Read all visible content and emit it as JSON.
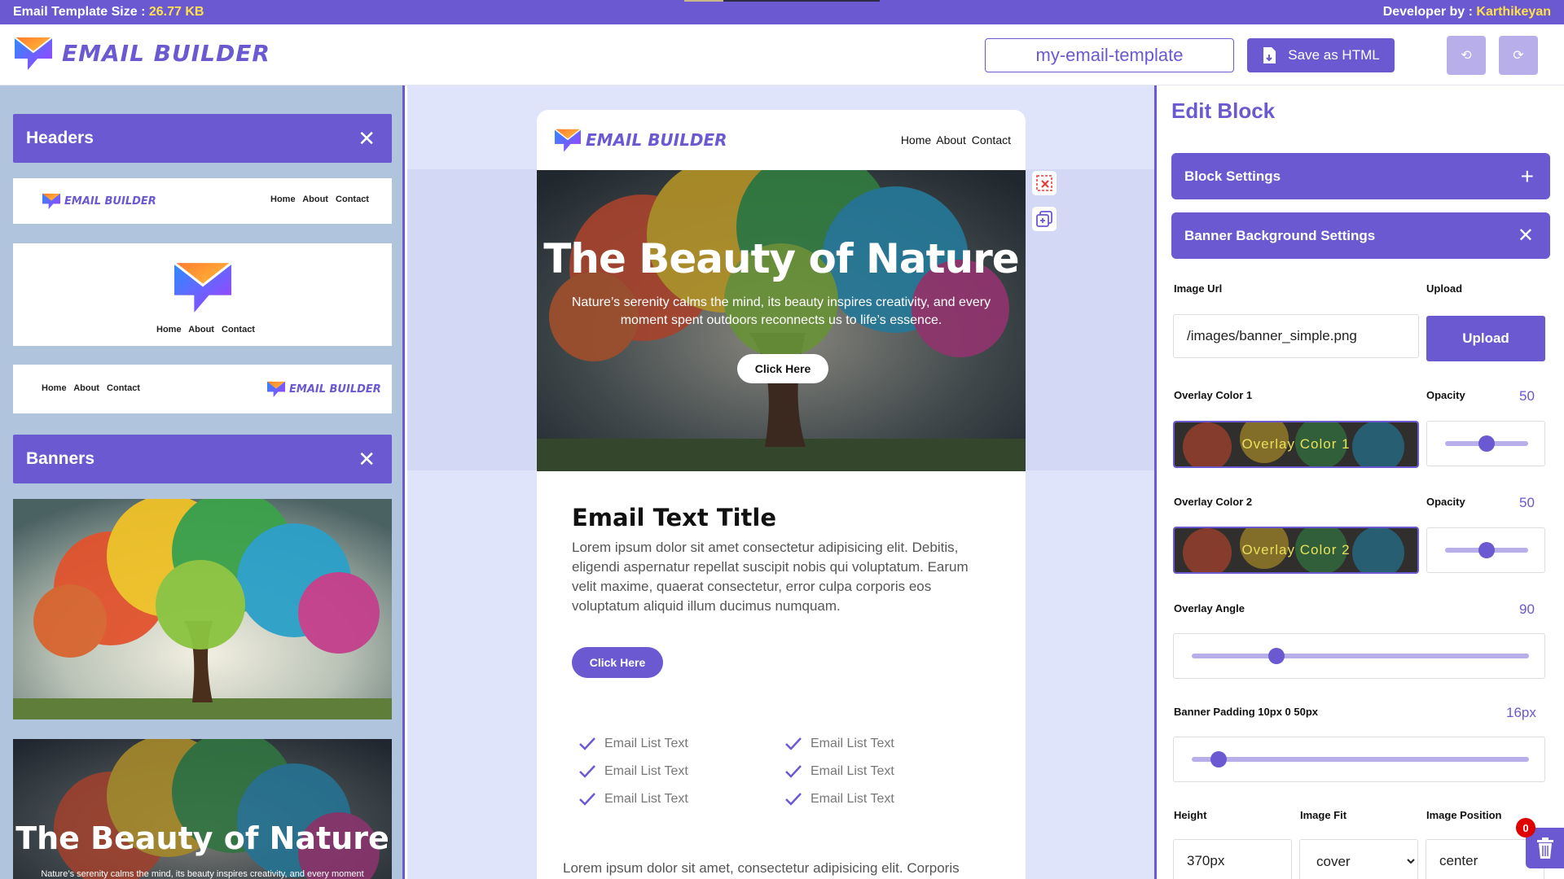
{
  "topbar": {
    "size_label": "Email Template Size : ",
    "size_value": "26.77 KB",
    "dev_label": "Developer by : ",
    "dev_name": "Karthikeyan"
  },
  "header": {
    "logo_text": "EMAIL BUILDER",
    "template_name": "my-email-template",
    "save_label": "Save as HTML"
  },
  "sidebar": {
    "headers_title": "Headers",
    "banners_title": "Banners",
    "thumb_nav": "Home About Contact",
    "thumb_logo": "EMAIL BUILDER",
    "banner2_title": "The Beauty of Nature",
    "banner2_text": "Nature’s serenity calms the mind, its beauty inspires creativity, and every moment"
  },
  "email": {
    "logo_text": "EMAIL BUILDER",
    "nav": "Home  About  Contact",
    "banner_title": "The Beauty of Nature",
    "banner_text": "Nature’s serenity calms the mind, its beauty inspires creativity, and every moment spent outdoors reconnects us to life’s essence.",
    "banner_button": "Click Here",
    "text_title": "Email Text Title",
    "text_body": "Lorem ipsum dolor sit amet consectetur adipisicing elit. Debitis, eligendi aspernatur repellat suscipit nobis qui voluptatum. Earum velit maxime, quaerat consectetur, error culpa corporis eos voluptatum aliquid illum ducimus numquam.",
    "text_button": "Click Here",
    "list_left": [
      "Email List Text",
      "Email List Text",
      "Email List Text"
    ],
    "list_right": [
      "Email List Text",
      "Email List Text",
      "Email List Text"
    ],
    "footer_text": "Lorem ipsum dolor sit amet, consectetur adipisicing elit. Corporis consequatur sequi ipsa commodi cumque vero unde, itaque"
  },
  "panel": {
    "title": "Edit Block",
    "block_settings": "Block Settings",
    "banner_bg_settings": "Banner Background Settings",
    "image_url_label": "Image Url",
    "upload_label": "Upload",
    "image_url_value": "/images/banner_simple.png",
    "upload_button": "Upload",
    "overlay1_label": "Overlay Color 1",
    "opacity1_label": "Opacity",
    "opacity1_value": "50",
    "overlay1_swatch": "Overlay Color 1",
    "overlay2_label": "Overlay Color 2",
    "opacity2_label": "Opacity",
    "opacity2_value": "50",
    "overlay2_swatch": "Overlay Color 2",
    "angle_label": "Overlay Angle",
    "angle_value": "90",
    "padding_label": "Banner Padding 10px 0 50px",
    "padding_value": "16px",
    "height_label": "Height",
    "fit_label": "Image Fit",
    "position_label": "Image Position",
    "height_value": "370px",
    "fit_value": "cover",
    "position_value": "center",
    "opacity1_level": 0.5,
    "opacity2_level": 0.5,
    "angle_level": 0.25,
    "padding_level": 0.08
  },
  "trash_badge": "0",
  "colors": {
    "accent": "#6a59d1",
    "accent_light": "#b7aeea",
    "sidebar_bg": "#b0c4de",
    "canvas_bg": "#e0e4fa",
    "highlight": "#ffe04a"
  },
  "icons": [
    "logo-envelope-icon",
    "save-file-icon",
    "undo-icon",
    "redo-icon",
    "close-icon",
    "plus-icon",
    "delete-block-icon",
    "duplicate-block-icon",
    "check-icon",
    "trash-icon",
    "chevron-down-icon"
  ]
}
